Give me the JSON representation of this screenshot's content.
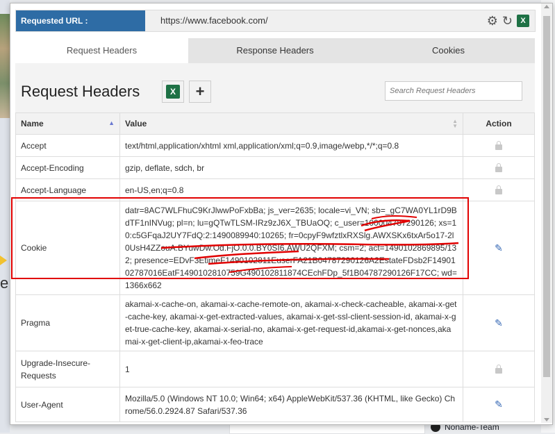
{
  "url_bar": {
    "label": "Requested URL :",
    "url": "https://www.facebook.com/",
    "icons": [
      "gear-icon",
      "refresh-icon",
      "excel-icon"
    ]
  },
  "tabs": [
    {
      "label": "Request Headers",
      "active": true
    },
    {
      "label": "Response Headers",
      "active": false
    },
    {
      "label": "Cookies",
      "active": false
    }
  ],
  "panel": {
    "title": "Request Headers",
    "search_placeholder": "Search Request Headers",
    "buttons": [
      "excel-export-button",
      "add-header-button"
    ]
  },
  "table": {
    "columns": [
      "Name",
      "Value",
      "Action"
    ],
    "rows": [
      {
        "name": "Accept",
        "value": "text/html,application/xhtml xml,application/xml;q=0.9,image/webp,*/*;q=0.8",
        "action": "lock"
      },
      {
        "name": "Accept-Encoding",
        "value": "gzip, deflate, sdch, br",
        "action": "lock"
      },
      {
        "name": "Accept-Language",
        "value": "en-US,en;q=0.8",
        "action": "lock"
      },
      {
        "name": "Cookie",
        "value": "datr=8AC7WLFhuC9KrJlwwPoFxbBa; js_ver=2635; locale=vi_VN; sb=_gC7WA0YL1rD9BdTF1nINVug; pl=n; lu=gQTwTLSM-IRz9zJ6X_TBUaOQ; c_user=100004787290126; xs=10:c5GFqaJ2UY7FdQ:2:1490089940:10265; fr=0cpyF9wfztlxRXSlg.AWXSKx6txAr5o17-2l0UsH4ZZouA.BYuwDw.Od.FjO.0.0.BY0SI6.AWU2QFXM; csm=2; act=1490102869895/132; presence=EDvF3EtimeF1490102811EuserFA21B04787290126A2EstateFDsb2F1490102787016EatF1490102810759G490102811874CEchFDp_5f1B04787290126F17CC; wd=1366x662",
        "action": "edit"
      },
      {
        "name": "Pragma",
        "value": "akamai-x-cache-on, akamai-x-cache-remote-on, akamai-x-check-cacheable, akamai-x-get-cache-key, akamai-x-get-extracted-values, akamai-x-get-ssl-client-session-id, akamai-x-get-true-cache-key, akamai-x-serial-no, akamai-x-get-request-id,akamai-x-get-nonces,akamai-x-get-client-ip,akamai-x-feo-trace",
        "action": "edit"
      },
      {
        "name": "Upgrade-Insecure-Requests",
        "value": "1",
        "action": "lock"
      },
      {
        "name": "User-Agent",
        "value": "Mozilla/5.0 (Windows NT 10.0; Win64; x64) AppleWebKit/537.36 (KHTML, like Gecko) Chrome/56.0.2924.87 Safari/537.36",
        "action": "edit"
      }
    ]
  },
  "background": {
    "team_name": "Noname-Team"
  },
  "colors": {
    "url_label_bg": "#2e6ca5",
    "highlight": "#e10000",
    "edit_icon": "#3568b5"
  }
}
